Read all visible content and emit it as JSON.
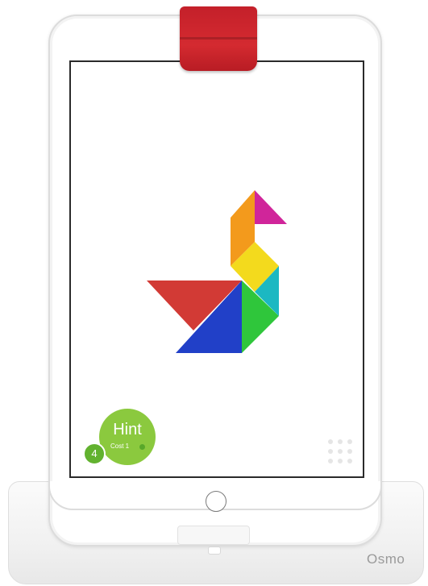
{
  "hint": {
    "label": "Hint",
    "cost_label": "Cost 1",
    "count": "4"
  },
  "brand": {
    "label": "Osmo"
  },
  "colors": {
    "clip_red": "#c4202a",
    "hint_green": "#8bc93e",
    "piece_red": "#d23a35",
    "piece_blue": "#2140c8",
    "piece_orange": "#f39a1c",
    "piece_magenta": "#d0259a",
    "piece_yellow": "#f3da1d",
    "piece_cyan": "#1cb8c2",
    "piece_green": "#2fc63b"
  },
  "icons": {
    "grid_menu": "grid-icon",
    "home": "home-button-icon"
  }
}
